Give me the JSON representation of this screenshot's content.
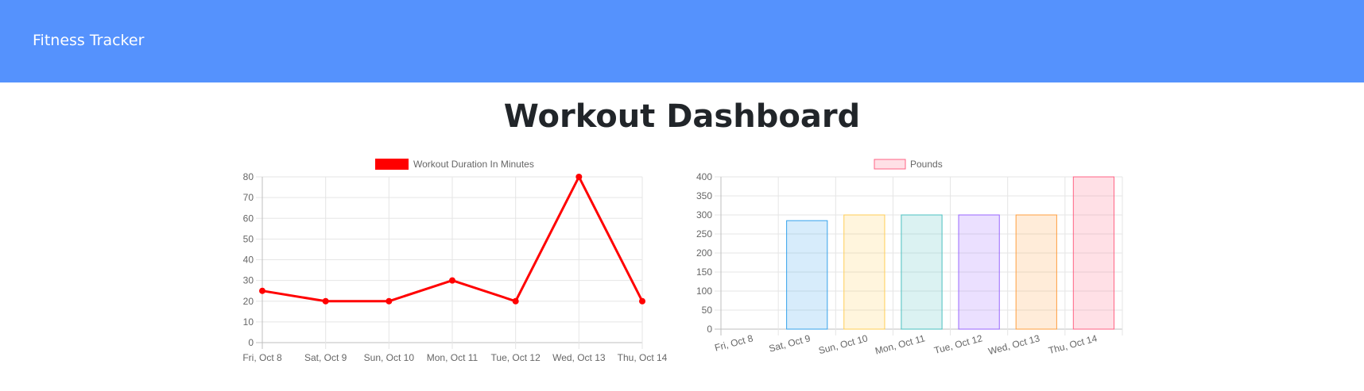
{
  "navbar": {
    "brand": "Fitness Tracker"
  },
  "page": {
    "title": "Workout Dashboard"
  },
  "chart_data": [
    {
      "type": "line",
      "categories": [
        "Fri, Oct 8",
        "Sat, Oct 9",
        "Sun, Oct 10",
        "Mon, Oct 11",
        "Tue, Oct 12",
        "Wed, Oct 13",
        "Thu, Oct 14"
      ],
      "series": [
        {
          "name": "Workout Duration In Minutes",
          "values": [
            25,
            20,
            20,
            30,
            20,
            80,
            20
          ],
          "color": "#ff0000"
        }
      ],
      "ylim": [
        0,
        80
      ],
      "yticks": [
        0,
        10,
        20,
        30,
        40,
        50,
        60,
        70,
        80
      ],
      "grid": true,
      "legend": "top-center"
    },
    {
      "type": "bar",
      "categories": [
        "Fri, Oct 8",
        "Sat, Oct 9",
        "Sun, Oct 10",
        "Mon, Oct 11",
        "Tue, Oct 12",
        "Wed, Oct 13",
        "Thu, Oct 14"
      ],
      "series": [
        {
          "name": "Pounds",
          "values": [
            0,
            285,
            300,
            300,
            300,
            300,
            400
          ]
        }
      ],
      "bar_fills": [
        "rgba(255,99,132,0.2)",
        "rgba(54,162,235,0.2)",
        "rgba(255,206,86,0.2)",
        "rgba(75,192,192,0.2)",
        "rgba(153,102,255,0.2)",
        "rgba(255,159,64,0.2)",
        "rgba(255,99,132,0.2)"
      ],
      "bar_borders": [
        "#ff6384",
        "#36a2eb",
        "#ffce56",
        "#4bc0c0",
        "#9966ff",
        "#ff9f40",
        "#ff6384"
      ],
      "ylim": [
        0,
        400
      ],
      "yticks": [
        0,
        50,
        100,
        150,
        200,
        250,
        300,
        350,
        400
      ],
      "grid": true,
      "legend": "top-center"
    }
  ]
}
